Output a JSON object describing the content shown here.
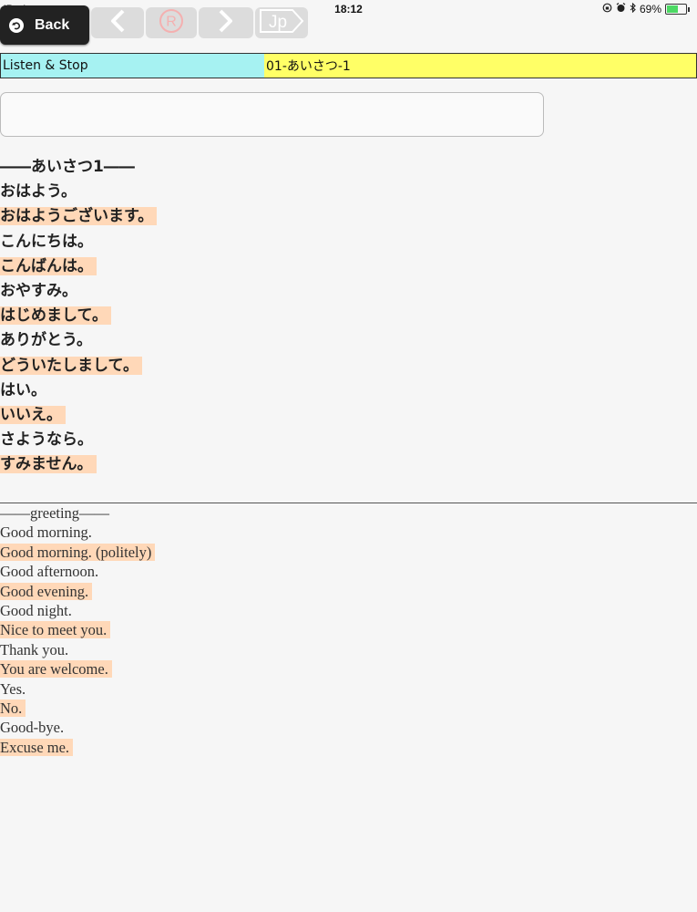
{
  "status_bar": {
    "device": "iPad",
    "time": "18:12",
    "battery": "69%",
    "battery_level": 0.69
  },
  "toolbar": {
    "back_label": "Back",
    "rec_symbol": "R",
    "jp_label": "Jp"
  },
  "header": {
    "mode": "Listen & Stop",
    "lesson": "01-あいさつ-1"
  },
  "input": {
    "value": "",
    "placeholder": ""
  },
  "japanese": {
    "lines": [
      "――あいさつ1――",
      "おはよう。",
      "おはようございます。",
      "こんにちは。",
      "こんばんは。",
      "おやすみ。",
      "はじめまして。",
      "ありがとう。",
      "どういたしまして。",
      "はい。",
      "いいえ。",
      "さようなら。",
      "すみません。"
    ]
  },
  "english": {
    "lines": [
      "――greeting――",
      "Good morning.",
      "Good morning. (politely)",
      "Good afternoon.",
      "Good evening.",
      "Good night.",
      "Nice to meet you.",
      "Thank you.",
      "You are welcome.",
      "Yes.",
      "No.",
      "Good-bye.",
      "Excuse me."
    ]
  },
  "colors": {
    "mode_bg": "#a6f2f2",
    "lesson_bg": "#ffff66",
    "highlight": "#ffd8b8"
  }
}
